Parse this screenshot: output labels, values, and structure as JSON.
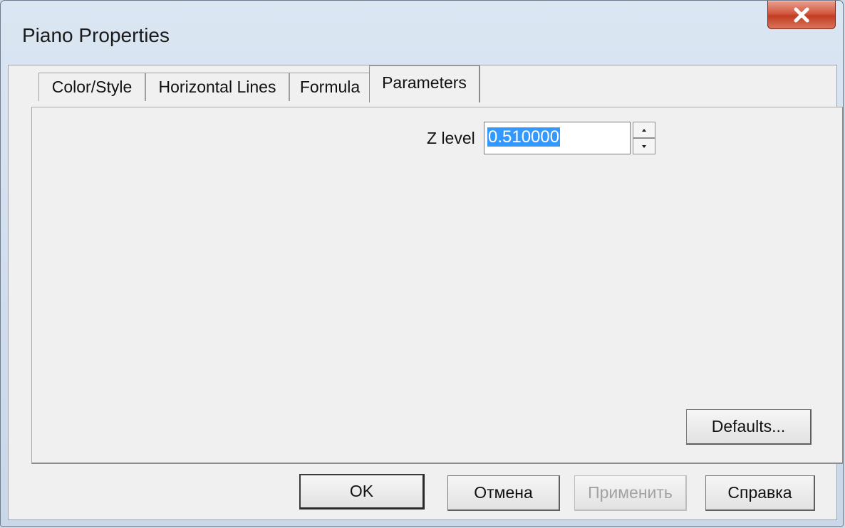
{
  "window": {
    "title": "Piano Properties"
  },
  "tabs": [
    {
      "label": "Color/Style"
    },
    {
      "label": "Horizontal Lines"
    },
    {
      "label": "Formula"
    },
    {
      "label": "Parameters"
    }
  ],
  "parameters": {
    "z_level_label": "Z level",
    "z_level_value": "0.510000",
    "defaults_label": "Defaults..."
  },
  "buttons": {
    "ok": "OK",
    "cancel": "Отмена",
    "apply": "Применить",
    "help": "Справка"
  }
}
